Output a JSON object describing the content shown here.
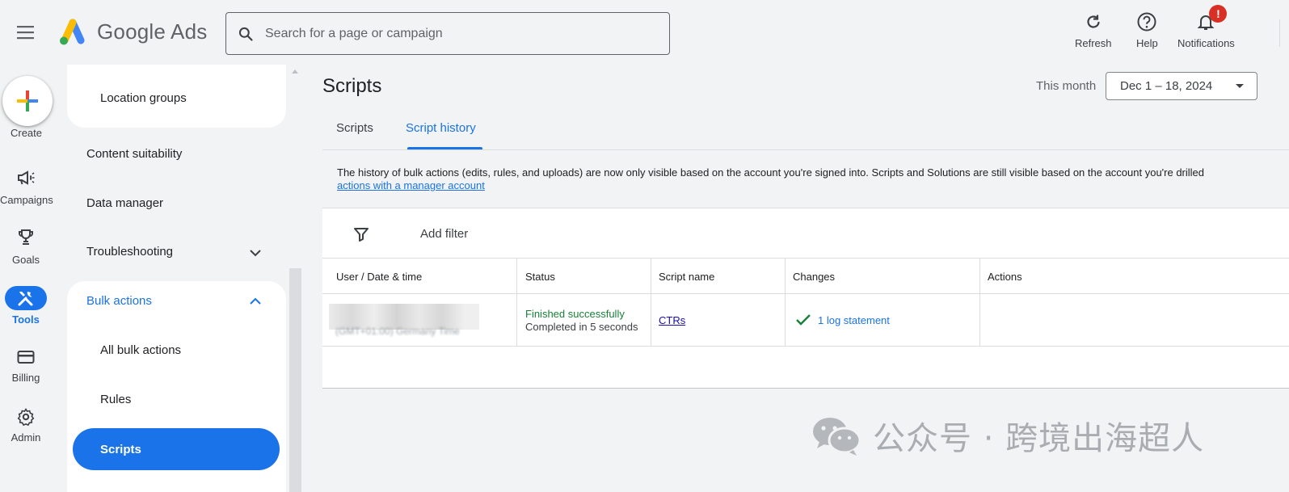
{
  "header": {
    "brand": "Google Ads",
    "search_placeholder": "Search for a page or campaign",
    "actions": [
      {
        "label": "Refresh",
        "icon": "refresh-icon"
      },
      {
        "label": "Help",
        "icon": "help-icon"
      },
      {
        "label": "Notifications",
        "icon": "bell-icon",
        "badge": "!"
      }
    ]
  },
  "rail": {
    "create_label": "Create",
    "items": [
      {
        "label": "Campaigns",
        "icon": "megaphone-icon"
      },
      {
        "label": "Goals",
        "icon": "trophy-icon"
      },
      {
        "label": "Tools",
        "icon": "tools-icon",
        "active": true
      },
      {
        "label": "Billing",
        "icon": "credit-card-icon"
      },
      {
        "label": "Admin",
        "icon": "gear-icon"
      }
    ]
  },
  "subnav": {
    "location_groups": "Location groups",
    "content_suitability": "Content suitability",
    "data_manager": "Data manager",
    "troubleshooting": "Troubleshooting",
    "bulk_actions": "Bulk actions",
    "all_bulk_actions": "All bulk actions",
    "rules": "Rules",
    "scripts": "Scripts"
  },
  "main": {
    "title": "Scripts",
    "date_label": "This month",
    "date_range": "Dec 1 – 18, 2024",
    "tabs": [
      {
        "label": "Scripts",
        "active": false
      },
      {
        "label": "Script history",
        "active": true
      }
    ],
    "notice": "The history of bulk actions (edits, rules, and uploads) are now only visible based on the account you're signed into. Scripts and Solutions are still visible based on the account you're drilled",
    "notice_link": "actions with a manager account",
    "filter_label": "Add filter",
    "table": {
      "columns": [
        "User / Date & time",
        "Status",
        "Script name",
        "Changes",
        "Actions"
      ],
      "rows": [
        {
          "user_sub": "(GMT+01:00) Germany Time",
          "status": "Finished successfully",
          "status_detail": "Completed in 5 seconds",
          "script_name": "CTRs",
          "changes": "1 log statement",
          "actions": ""
        }
      ]
    }
  },
  "watermark": {
    "text": "公众号 · 跨境出海超人"
  },
  "colors": {
    "accent": "#1a73e8",
    "success": "#188038",
    "badge": "#d93025"
  }
}
